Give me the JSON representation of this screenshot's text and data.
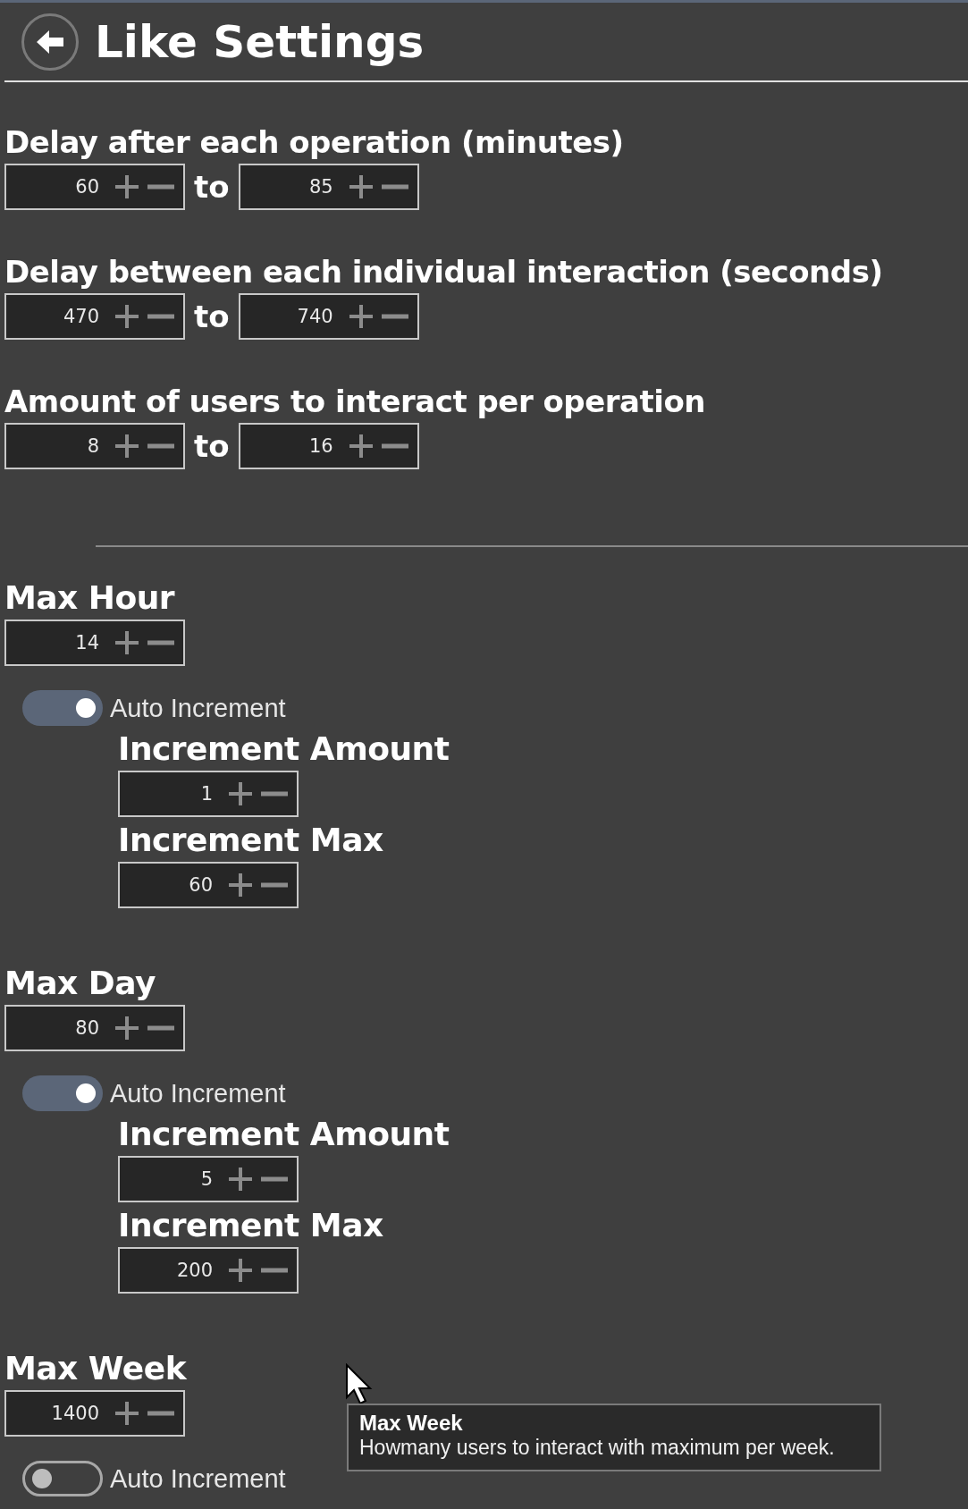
{
  "header": {
    "title": "Like Settings"
  },
  "ranges": [
    {
      "label": "Delay after each operation (minutes)",
      "from": "60",
      "separator": "to",
      "to": "85"
    },
    {
      "label": "Delay between each individual interaction (seconds)",
      "from": "470",
      "separator": "to",
      "to": "740"
    },
    {
      "label": "Amount of users to interact per operation",
      "from": "8",
      "separator": "to",
      "to": "16"
    }
  ],
  "limits": [
    {
      "label": "Max Hour",
      "value": "14",
      "auto_increment": {
        "label": "Auto Increment",
        "on": true
      },
      "increment_amount": {
        "label": "Increment Amount",
        "value": "1"
      },
      "increment_max": {
        "label": "Increment Max",
        "value": "60"
      }
    },
    {
      "label": "Max Day",
      "value": "80",
      "auto_increment": {
        "label": "Auto Increment",
        "on": true
      },
      "increment_amount": {
        "label": "Increment Amount",
        "value": "5"
      },
      "increment_max": {
        "label": "Increment Max",
        "value": "200"
      }
    },
    {
      "label": "Max Week",
      "value": "1400",
      "auto_increment": {
        "label": "Auto Increment",
        "on": false
      }
    }
  ],
  "tooltip": {
    "title": "Max Week",
    "text": "Howmany users to interact with maximum per week."
  }
}
